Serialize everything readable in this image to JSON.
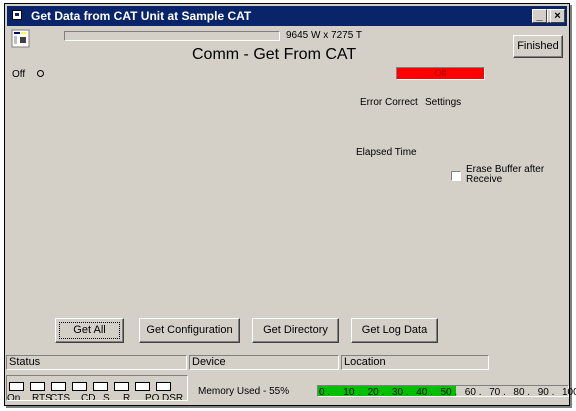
{
  "window": {
    "title": "Get Data from  CAT Unit at Sample CAT",
    "minimize_label": "_",
    "maximize_label": "□",
    "close_label": "×"
  },
  "header": {
    "dimension_text": "9645 W x 7275 T",
    "page_title": "Comm - Get From CAT",
    "finished_label": "Finished"
  },
  "connection": {
    "off_label": "Off",
    "status_bar_label": "Off",
    "status_bar_color": "#ff0000"
  },
  "info": {
    "error_correct_label": "Error Correct",
    "settings_label": "Settings",
    "elapsed_time_label": "Elapsed Time",
    "erase_buffer_label_1": "Erase Buffer after",
    "erase_buffer_label_2": "Receive",
    "erase_buffer_checked": false
  },
  "actions": {
    "get_all": "Get All",
    "get_configuration": "Get Configuration",
    "get_directory": "Get Directory",
    "get_log_data": "Get Log Data"
  },
  "status_bar": {
    "status_label": "Status",
    "device_label": "Device",
    "location_label": "Location"
  },
  "indicators": [
    "On",
    "RTS",
    "CTS",
    "CD",
    "S",
    "R",
    "PO",
    "DSR"
  ],
  "memory": {
    "label": "Memory Used - 55%",
    "percent": 55,
    "fill_color": "#00c000",
    "ticks": [
      "0",
      "10",
      "20",
      "30",
      "40",
      "50",
      "60",
      "70",
      "80",
      "90",
      "100"
    ]
  }
}
